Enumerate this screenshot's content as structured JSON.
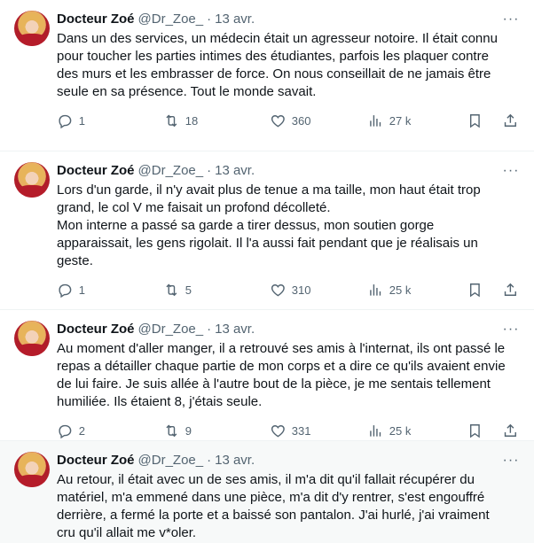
{
  "tweets": [
    {
      "name": "Docteur Zoé",
      "handle": "@Dr_Zoe_",
      "dot": "·",
      "date": "13 avr.",
      "text": "Dans un des services, un médecin était un agresseur notoire. Il était connu\npour toucher les parties intimes des étudiantes, parfois les plaquer contre\ndes murs et les embrasser de force. On nous conseillait de ne jamais être\nseule en sa présence. Tout le monde savait.",
      "replies": "1",
      "retweets": "18",
      "likes": "360",
      "views": "27 k"
    },
    {
      "name": "Docteur Zoé",
      "handle": "@Dr_Zoe_",
      "dot": "·",
      "date": "13 avr.",
      "text": "Lors d'un garde, il n'y avait plus de tenue a ma taille, mon haut était trop\ngrand, le col V me faisait un profond décolleté.\nMon interne a passé sa garde a tirer dessus, mon soutien gorge\napparaissait, les gens rigolait. Il l'a aussi fait pendant que je réalisais un\ngeste.",
      "replies": "1",
      "retweets": "5",
      "likes": "310",
      "views": "25 k"
    },
    {
      "name": "Docteur Zoé",
      "handle": "@Dr_Zoe_",
      "dot": "·",
      "date": "13 avr.",
      "text": "Au moment d'aller manger, il a retrouvé ses amis à l'internat, ils ont passé le\nrepas a détailler chaque partie de mon corps et a dire ce qu'ils avaient envie\nde lui faire. Je suis allée à l'autre bout de la pièce, je me sentais tellement\nhumiliée. Ils étaient 8, j'étais seule.",
      "replies": "2",
      "retweets": "9",
      "likes": "331",
      "views": "25 k"
    },
    {
      "name": "Docteur Zoé",
      "handle": "@Dr_Zoe_",
      "dot": "·",
      "date": "13 avr.",
      "text": "Au retour, il était avec un de ses amis, il m'a dit qu'il fallait récupérer du\nmatériel, m'a emmené dans une pièce, m'a dit d'y rentrer, s'est engouffré\nderrière, a fermé la porte et a baissé son pantalon. J'ai hurlé, j'ai vraiment\ncru qu'il allait me v*oler."
    }
  ],
  "more_glyph": "···"
}
